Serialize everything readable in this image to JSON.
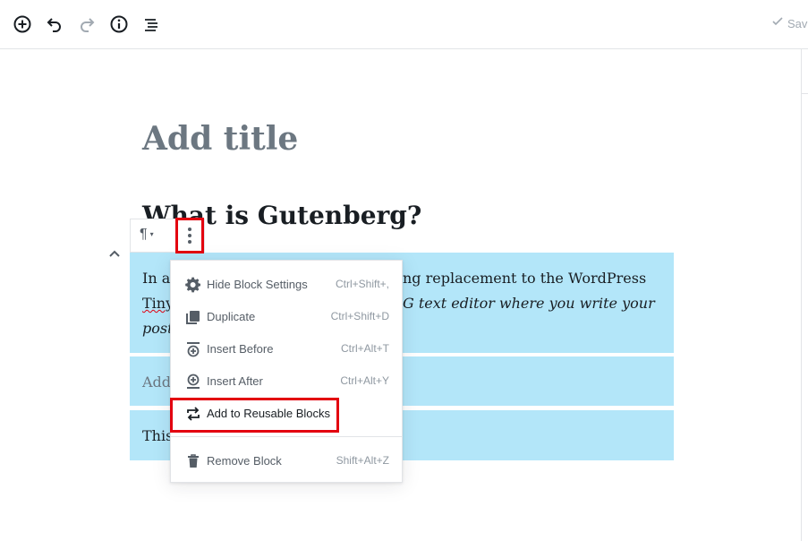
{
  "toolbar": {
    "add_icon": "plus-circle-icon",
    "undo_icon": "undo-icon",
    "redo_icon": "redo-icon",
    "info_icon": "info-icon",
    "outline_icon": "list-icon",
    "save_label": "Sav"
  },
  "post": {
    "title_placeholder": "Add title",
    "heading": "What is Gutenberg?",
    "para1_line1": "In a",
    "para1_line1_right": "ng replacement to the WordPress",
    "para1_line2": "Tiny",
    "para1_line2_right": "G text editor where you write your",
    "para1_line3": "post",
    "para2_placeholder": "Add",
    "para3_text": "This"
  },
  "block_toolbar": {
    "paragraph_symbol": "¶",
    "caret": "▾"
  },
  "block_menu": {
    "items": [
      {
        "label": "Hide Block Settings",
        "shortcut": "Ctrl+Shift+,",
        "icon": "gear-icon"
      },
      {
        "label": "Duplicate",
        "shortcut": "Ctrl+Shift+D",
        "icon": "duplicate-icon"
      },
      {
        "label": "Insert Before",
        "shortcut": "Ctrl+Alt+T",
        "icon": "insert-before-icon"
      },
      {
        "label": "Insert After",
        "shortcut": "Ctrl+Alt+Y",
        "icon": "insert-after-icon"
      },
      {
        "label": "Add to Reusable Blocks",
        "shortcut": "",
        "icon": "reusable-icon"
      },
      {
        "label": "Remove Block",
        "shortcut": "Shift+Alt+Z",
        "icon": "trash-icon"
      }
    ]
  },
  "colors": {
    "selection": "#b3e6f9",
    "highlight": "#e3000f"
  }
}
